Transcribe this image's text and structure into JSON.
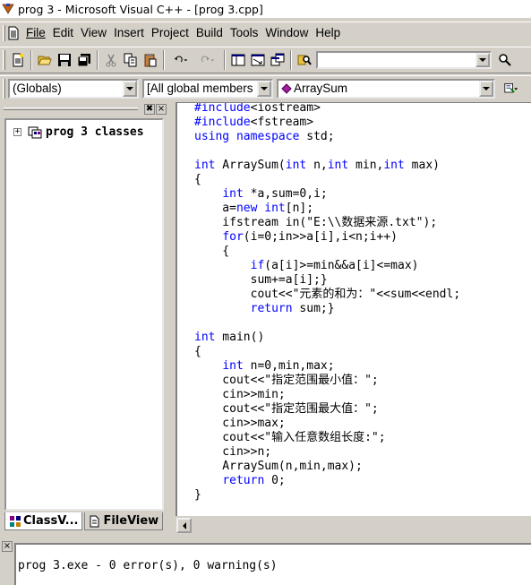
{
  "window": {
    "title": "prog 3 - Microsoft Visual C++ - [prog 3.cpp]"
  },
  "menu": [
    "File",
    "Edit",
    "View",
    "Insert",
    "Project",
    "Build",
    "Tools",
    "Window",
    "Help"
  ],
  "toolbar": {
    "icons": [
      "new-text-file-icon",
      "open-folder-icon",
      "save-icon",
      "save-all-icon",
      "cut-icon",
      "copy-icon",
      "paste-icon",
      "undo-icon",
      "redo-icon",
      "workspace-icon",
      "output-icon",
      "window-list-icon",
      "find-in-files-icon"
    ],
    "find_value": ""
  },
  "wizardbar": {
    "class_combo": "(Globals)",
    "filter_combo": "[All global members",
    "member_combo": "ArraySum"
  },
  "workspace": {
    "tree_root": "prog 3 classes",
    "tabs": [
      "ClassV...",
      "FileView"
    ]
  },
  "editor": {
    "lines": [
      [
        {
          "t": "#include",
          "k": 1
        },
        {
          "t": "<iostream>",
          "k": 0
        }
      ],
      [
        {
          "t": "#include",
          "k": 1
        },
        {
          "t": "<fstream>",
          "k": 0
        }
      ],
      [
        {
          "t": "using",
          "k": 1
        },
        {
          "t": " ",
          "k": 0
        },
        {
          "t": "namespace",
          "k": 1
        },
        {
          "t": " std;",
          "k": 0
        }
      ],
      [],
      [
        {
          "t": "int",
          "k": 1
        },
        {
          "t": " ArraySum(",
          "k": 0
        },
        {
          "t": "int",
          "k": 1
        },
        {
          "t": " n,",
          "k": 0
        },
        {
          "t": "int",
          "k": 1
        },
        {
          "t": " min,",
          "k": 0
        },
        {
          "t": "int",
          "k": 1
        },
        {
          "t": " max)",
          "k": 0
        }
      ],
      [
        {
          "t": "{",
          "k": 0
        }
      ],
      [
        {
          "t": "    ",
          "k": 0
        },
        {
          "t": "int",
          "k": 1
        },
        {
          "t": " *a,sum=0,i;",
          "k": 0
        }
      ],
      [
        {
          "t": "    a=",
          "k": 0
        },
        {
          "t": "new",
          "k": 1
        },
        {
          "t": " ",
          "k": 0
        },
        {
          "t": "int",
          "k": 1
        },
        {
          "t": "[n];",
          "k": 0
        }
      ],
      [
        {
          "t": "    ifstream in(\"E:\\\\数据来源.txt\");",
          "k": 0
        }
      ],
      [
        {
          "t": "    ",
          "k": 0
        },
        {
          "t": "for",
          "k": 1
        },
        {
          "t": "(i=0;in>>a[i],i<n;i++)",
          "k": 0
        }
      ],
      [
        {
          "t": "    {",
          "k": 0
        }
      ],
      [
        {
          "t": "        ",
          "k": 0
        },
        {
          "t": "if",
          "k": 1
        },
        {
          "t": "(a[i]>=min&&a[i]<=max)",
          "k": 0
        }
      ],
      [
        {
          "t": "        sum+=a[i];}",
          "k": 0
        }
      ],
      [
        {
          "t": "        cout<<\"元素的和为：\"<<sum<<endl;",
          "k": 0
        }
      ],
      [
        {
          "t": "        ",
          "k": 0
        },
        {
          "t": "return",
          "k": 1
        },
        {
          "t": " sum;}",
          "k": 0
        }
      ],
      [],
      [
        {
          "t": "int",
          "k": 1
        },
        {
          "t": " main()",
          "k": 0
        }
      ],
      [
        {
          "t": "{",
          "k": 0
        }
      ],
      [
        {
          "t": "    ",
          "k": 0
        },
        {
          "t": "int",
          "k": 1
        },
        {
          "t": " n=0,min,max;",
          "k": 0
        }
      ],
      [
        {
          "t": "    cout<<\"指定范围最小值：\";",
          "k": 0
        }
      ],
      [
        {
          "t": "    cin>>min;",
          "k": 0
        }
      ],
      [
        {
          "t": "    cout<<\"指定范围最大值：\";",
          "k": 0
        }
      ],
      [
        {
          "t": "    cin>>max;",
          "k": 0
        }
      ],
      [
        {
          "t": "    cout<<\"输入任意数组长度:\";",
          "k": 0
        }
      ],
      [
        {
          "t": "    cin>>n;",
          "k": 0
        }
      ],
      [
        {
          "t": "    ArraySum(n,min,max);",
          "k": 0
        }
      ],
      [
        {
          "t": "    ",
          "k": 0
        },
        {
          "t": "return",
          "k": 1
        },
        {
          "t": " 0;",
          "k": 0
        }
      ],
      [
        {
          "t": "}",
          "k": 0
        }
      ]
    ]
  },
  "output": {
    "text": "prog 3.exe - 0 error(s), 0 warning(s)"
  },
  "colors": {
    "keyword": "#0000ff",
    "chrome": "#d4d0c8"
  }
}
